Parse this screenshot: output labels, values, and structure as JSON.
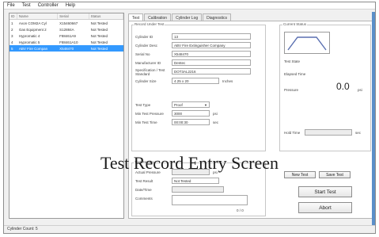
{
  "menu": {
    "items": [
      "File",
      "Test",
      "Controller",
      "Help"
    ]
  },
  "list": {
    "columns": {
      "id": "ID",
      "name": "Name",
      "serial": "Serial",
      "status": "Status"
    },
    "rows": [
      {
        "id": "1",
        "name": "Avon COM2A Cyl",
        "serial": "X15460667",
        "status": "Not Tested"
      },
      {
        "id": "2",
        "name": "Gas Equipment 2",
        "serial": "S12884A",
        "status": "Not Tested"
      },
      {
        "id": "3",
        "name": "Hypromatic 4",
        "serial": "F88461A9",
        "status": "Not Tested"
      },
      {
        "id": "4",
        "name": "Hypromatic 5",
        "serial": "F88461A10",
        "status": "Not Tested"
      },
      {
        "id": "5",
        "name": "ABV Fire Compan",
        "serial": "X548470",
        "status": "Not Tested"
      }
    ]
  },
  "tabs": [
    "Test",
    "Calibration",
    "Cylinder Log",
    "Diagnostics"
  ],
  "details": {
    "legend": "Record Under Test",
    "cylinder_id_label": "Cylinder ID",
    "cylinder_id": "13",
    "cylinder_desc_label": "Cylinder Desc",
    "cylinder_desc": "ABV Fire Extinguisher Company",
    "serial_label": "Serial No",
    "serial": "X548470",
    "manufacturer_label": "Manufacturer ID",
    "manufacturer": "Dentec",
    "spec_label": "Specification / Test Standard",
    "spec": "DOT3AL2216",
    "cylinder_size_label": "Cylinder Size",
    "cylinder_size": "4.25 x 20",
    "cylinder_size_unit": "Inches",
    "test_type_label": "Test Type",
    "test_type": "Proof",
    "min_pressure_label": "Min Test Pressure",
    "min_pressure": "3000",
    "min_pressure_unit": "psi",
    "min_time_label": "Min Test Time",
    "min_time": "00:00:30",
    "min_time_unit": "sec"
  },
  "status": {
    "legend": "Current Status",
    "test_state_label": "Test State",
    "elapsed_label": "Elapsed Time",
    "pressure_label": "Pressure",
    "pressure_value": "0.0",
    "pressure_unit": "psi",
    "hold_time_label": "Hold Time",
    "hold_time_unit": "sec"
  },
  "results": {
    "legend": "Test Results",
    "actual_pressure_label": "Actual Pressure",
    "actual_pressure_unit": "psi",
    "result_label": "Test Result",
    "result": "Not Tested",
    "date_label": "Date/Time",
    "comments_label": "Comments",
    "counter": "0 / 0"
  },
  "buttons": {
    "new_test": "New Test",
    "save_test": "Save Test",
    "start_test": "Start Test",
    "abort": "Abort"
  },
  "overlay_title": "Test Record Entry Screen",
  "statusbar": "Cylinder Count: 5"
}
